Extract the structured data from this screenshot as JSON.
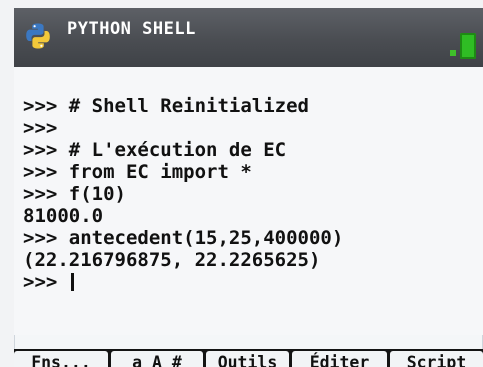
{
  "titlebar": {
    "title": "PYTHON SHELL",
    "logo_icon": "python-logo-icon",
    "battery_icon": "battery-icon"
  },
  "console": {
    "lines": [
      ">>> # Shell Reinitialized",
      ">>>",
      ">>> # L'exécution de EC",
      ">>> from EC import *",
      ">>> f(10)",
      "81000.0",
      ">>> antecedent(15,25,400000)",
      "(22.216796875, 22.2265625)",
      ">>> "
    ]
  },
  "softkeys": [
    {
      "label": "Fns..."
    },
    {
      "label": "a A #"
    },
    {
      "label": "Outils"
    },
    {
      "label": "Éditer"
    },
    {
      "label": "Script"
    }
  ],
  "colors": {
    "titlebar": "#4a4d52",
    "screen_bg": "#f6f7f9",
    "battery_green": "#2fbd24",
    "softbar_bg": "#141414"
  }
}
